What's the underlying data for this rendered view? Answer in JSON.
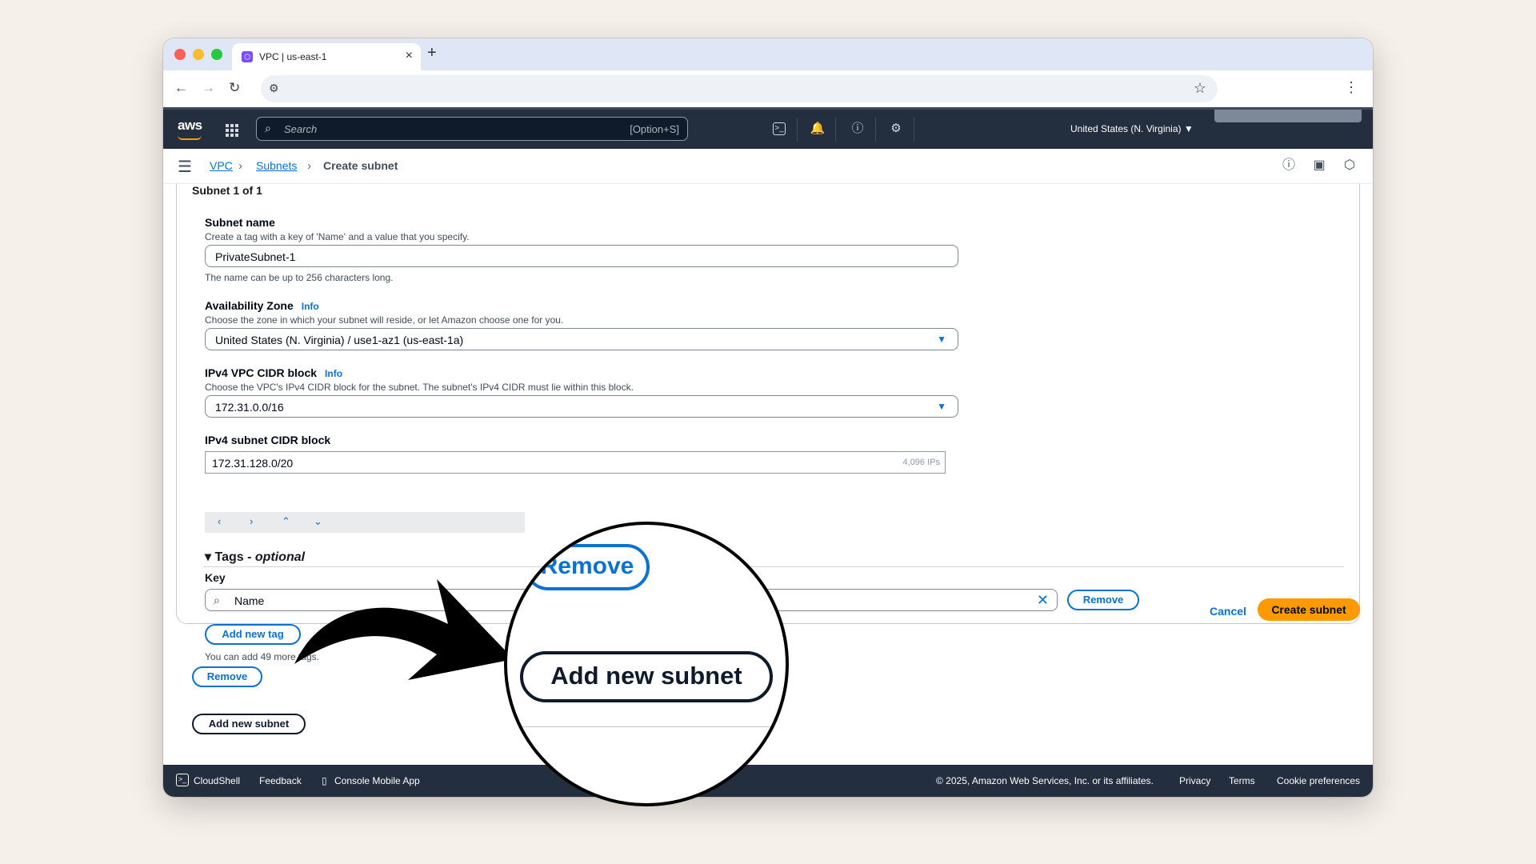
{
  "browser": {
    "tab_title": "VPC | us-east-1",
    "tab_favicon": "⬡",
    "new_tab_icon": "+",
    "close_tab_icon": "×"
  },
  "aws_nav": {
    "logo": "aws",
    "search_placeholder": "Search",
    "search_shortcut": "[Option+S]",
    "region": "United States (N. Virginia) ▼"
  },
  "breadcrumb": {
    "items": [
      "VPC",
      "Subnets"
    ],
    "current": "Create subnet"
  },
  "form": {
    "section_title": "Subnet 1 of 1",
    "subnet_name": {
      "label": "Subnet name",
      "description": "Create a tag with a key of 'Name' and a value that you specify.",
      "value": "PrivateSubnet-1",
      "constraint": "The name can be up to 256 characters long."
    },
    "availability_zone": {
      "label": "Availability Zone",
      "info": "Info",
      "description": "Choose the zone in which your subnet will reside, or let Amazon choose one for you.",
      "value": "United States (N. Virginia) / use1-az1 (us-east-1a)"
    },
    "vpc_cidr": {
      "label": "IPv4 VPC CIDR block",
      "info": "Info",
      "description": "Choose the VPC's IPv4 CIDR block for the subnet. The subnet's IPv4 CIDR must lie within this block.",
      "value": "172.31.0.0/16"
    },
    "subnet_cidr": {
      "label": "IPv4 subnet CIDR block",
      "value": "172.31.128.0/20",
      "ip_count": "4,096 IPs"
    },
    "tags": {
      "title": "Tags - ",
      "title_optional": "optional",
      "key_label": "Key",
      "key_value": "Name",
      "remove_label": "Remove",
      "add_tag_label": "Add new tag",
      "note": "You can add 49 more tags."
    },
    "remove_subnet_label": "Remove",
    "add_subnet_label": "Add new subnet"
  },
  "actions": {
    "cancel": "Cancel",
    "create": "Create subnet"
  },
  "footer": {
    "cloudshell": "CloudShell",
    "feedback": "Feedback",
    "mobile_app": "Console Mobile App",
    "copyright": "© 2025, Amazon Web Services, Inc. or its affiliates.",
    "privacy": "Privacy",
    "terms": "Terms",
    "cookies": "Cookie preferences"
  },
  "magnifier": {
    "remove_label": "Remove",
    "add_subnet_label": "Add new subnet"
  },
  "colors": {
    "aws_nav_bg": "#232f3e",
    "link_blue": "#0972d3",
    "primary_orange": "#ff9900",
    "page_bg": "#f6f0ea"
  }
}
